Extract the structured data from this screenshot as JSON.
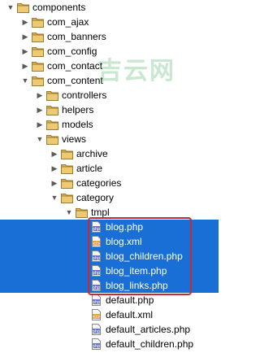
{
  "watermark": "吉云网",
  "tree": [
    {
      "label": "components",
      "type": "folder",
      "expanded": true,
      "selected": false
    },
    {
      "label": "com_ajax",
      "type": "folder",
      "expanded": false,
      "selected": false
    },
    {
      "label": "com_banners",
      "type": "folder",
      "expanded": false,
      "selected": false
    },
    {
      "label": "com_config",
      "type": "folder",
      "expanded": false,
      "selected": false
    },
    {
      "label": "com_contact",
      "type": "folder",
      "expanded": false,
      "selected": false
    },
    {
      "label": "com_content",
      "type": "folder",
      "expanded": true,
      "selected": false
    },
    {
      "label": "controllers",
      "type": "folder",
      "expanded": false,
      "selected": false
    },
    {
      "label": "helpers",
      "type": "folder",
      "expanded": false,
      "selected": false
    },
    {
      "label": "models",
      "type": "folder",
      "expanded": false,
      "selected": false
    },
    {
      "label": "views",
      "type": "folder",
      "expanded": true,
      "selected": false
    },
    {
      "label": "archive",
      "type": "folder",
      "expanded": false,
      "selected": false
    },
    {
      "label": "article",
      "type": "folder",
      "expanded": false,
      "selected": false
    },
    {
      "label": "categories",
      "type": "folder",
      "expanded": false,
      "selected": false
    },
    {
      "label": "category",
      "type": "folder",
      "expanded": true,
      "selected": false
    },
    {
      "label": "tmpl",
      "type": "folder",
      "expanded": true,
      "selected": false
    },
    {
      "label": "blog.php",
      "type": "php",
      "selected": true
    },
    {
      "label": "blog.xml",
      "type": "xml",
      "selected": true
    },
    {
      "label": "blog_children.php",
      "type": "php",
      "selected": true
    },
    {
      "label": "blog_item.php",
      "type": "php",
      "selected": true
    },
    {
      "label": "blog_links.php",
      "type": "php",
      "selected": true
    },
    {
      "label": "default.php",
      "type": "php",
      "selected": false
    },
    {
      "label": "default.xml",
      "type": "xml",
      "selected": false
    },
    {
      "label": "default_articles.php",
      "type": "php",
      "selected": false
    },
    {
      "label": "default_children.php",
      "type": "php",
      "selected": false
    }
  ]
}
